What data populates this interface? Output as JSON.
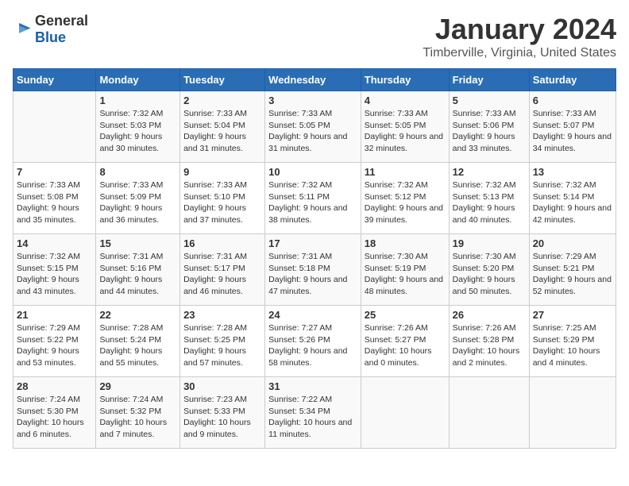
{
  "header": {
    "logo_general": "General",
    "logo_blue": "Blue",
    "month": "January 2024",
    "location": "Timberville, Virginia, United States"
  },
  "weekdays": [
    "Sunday",
    "Monday",
    "Tuesday",
    "Wednesday",
    "Thursday",
    "Friday",
    "Saturday"
  ],
  "weeks": [
    [
      {
        "day": "",
        "sunrise": "",
        "sunset": "",
        "daylight": ""
      },
      {
        "day": "1",
        "sunrise": "Sunrise: 7:32 AM",
        "sunset": "Sunset: 5:03 PM",
        "daylight": "Daylight: 9 hours and 30 minutes."
      },
      {
        "day": "2",
        "sunrise": "Sunrise: 7:33 AM",
        "sunset": "Sunset: 5:04 PM",
        "daylight": "Daylight: 9 hours and 31 minutes."
      },
      {
        "day": "3",
        "sunrise": "Sunrise: 7:33 AM",
        "sunset": "Sunset: 5:05 PM",
        "daylight": "Daylight: 9 hours and 31 minutes."
      },
      {
        "day": "4",
        "sunrise": "Sunrise: 7:33 AM",
        "sunset": "Sunset: 5:05 PM",
        "daylight": "Daylight: 9 hours and 32 minutes."
      },
      {
        "day": "5",
        "sunrise": "Sunrise: 7:33 AM",
        "sunset": "Sunset: 5:06 PM",
        "daylight": "Daylight: 9 hours and 33 minutes."
      },
      {
        "day": "6",
        "sunrise": "Sunrise: 7:33 AM",
        "sunset": "Sunset: 5:07 PM",
        "daylight": "Daylight: 9 hours and 34 minutes."
      }
    ],
    [
      {
        "day": "7",
        "sunrise": "Sunrise: 7:33 AM",
        "sunset": "Sunset: 5:08 PM",
        "daylight": "Daylight: 9 hours and 35 minutes."
      },
      {
        "day": "8",
        "sunrise": "Sunrise: 7:33 AM",
        "sunset": "Sunset: 5:09 PM",
        "daylight": "Daylight: 9 hours and 36 minutes."
      },
      {
        "day": "9",
        "sunrise": "Sunrise: 7:33 AM",
        "sunset": "Sunset: 5:10 PM",
        "daylight": "Daylight: 9 hours and 37 minutes."
      },
      {
        "day": "10",
        "sunrise": "Sunrise: 7:32 AM",
        "sunset": "Sunset: 5:11 PM",
        "daylight": "Daylight: 9 hours and 38 minutes."
      },
      {
        "day": "11",
        "sunrise": "Sunrise: 7:32 AM",
        "sunset": "Sunset: 5:12 PM",
        "daylight": "Daylight: 9 hours and 39 minutes."
      },
      {
        "day": "12",
        "sunrise": "Sunrise: 7:32 AM",
        "sunset": "Sunset: 5:13 PM",
        "daylight": "Daylight: 9 hours and 40 minutes."
      },
      {
        "day": "13",
        "sunrise": "Sunrise: 7:32 AM",
        "sunset": "Sunset: 5:14 PM",
        "daylight": "Daylight: 9 hours and 42 minutes."
      }
    ],
    [
      {
        "day": "14",
        "sunrise": "Sunrise: 7:32 AM",
        "sunset": "Sunset: 5:15 PM",
        "daylight": "Daylight: 9 hours and 43 minutes."
      },
      {
        "day": "15",
        "sunrise": "Sunrise: 7:31 AM",
        "sunset": "Sunset: 5:16 PM",
        "daylight": "Daylight: 9 hours and 44 minutes."
      },
      {
        "day": "16",
        "sunrise": "Sunrise: 7:31 AM",
        "sunset": "Sunset: 5:17 PM",
        "daylight": "Daylight: 9 hours and 46 minutes."
      },
      {
        "day": "17",
        "sunrise": "Sunrise: 7:31 AM",
        "sunset": "Sunset: 5:18 PM",
        "daylight": "Daylight: 9 hours and 47 minutes."
      },
      {
        "day": "18",
        "sunrise": "Sunrise: 7:30 AM",
        "sunset": "Sunset: 5:19 PM",
        "daylight": "Daylight: 9 hours and 48 minutes."
      },
      {
        "day": "19",
        "sunrise": "Sunrise: 7:30 AM",
        "sunset": "Sunset: 5:20 PM",
        "daylight": "Daylight: 9 hours and 50 minutes."
      },
      {
        "day": "20",
        "sunrise": "Sunrise: 7:29 AM",
        "sunset": "Sunset: 5:21 PM",
        "daylight": "Daylight: 9 hours and 52 minutes."
      }
    ],
    [
      {
        "day": "21",
        "sunrise": "Sunrise: 7:29 AM",
        "sunset": "Sunset: 5:22 PM",
        "daylight": "Daylight: 9 hours and 53 minutes."
      },
      {
        "day": "22",
        "sunrise": "Sunrise: 7:28 AM",
        "sunset": "Sunset: 5:24 PM",
        "daylight": "Daylight: 9 hours and 55 minutes."
      },
      {
        "day": "23",
        "sunrise": "Sunrise: 7:28 AM",
        "sunset": "Sunset: 5:25 PM",
        "daylight": "Daylight: 9 hours and 57 minutes."
      },
      {
        "day": "24",
        "sunrise": "Sunrise: 7:27 AM",
        "sunset": "Sunset: 5:26 PM",
        "daylight": "Daylight: 9 hours and 58 minutes."
      },
      {
        "day": "25",
        "sunrise": "Sunrise: 7:26 AM",
        "sunset": "Sunset: 5:27 PM",
        "daylight": "Daylight: 10 hours and 0 minutes."
      },
      {
        "day": "26",
        "sunrise": "Sunrise: 7:26 AM",
        "sunset": "Sunset: 5:28 PM",
        "daylight": "Daylight: 10 hours and 2 minutes."
      },
      {
        "day": "27",
        "sunrise": "Sunrise: 7:25 AM",
        "sunset": "Sunset: 5:29 PM",
        "daylight": "Daylight: 10 hours and 4 minutes."
      }
    ],
    [
      {
        "day": "28",
        "sunrise": "Sunrise: 7:24 AM",
        "sunset": "Sunset: 5:30 PM",
        "daylight": "Daylight: 10 hours and 6 minutes."
      },
      {
        "day": "29",
        "sunrise": "Sunrise: 7:24 AM",
        "sunset": "Sunset: 5:32 PM",
        "daylight": "Daylight: 10 hours and 7 minutes."
      },
      {
        "day": "30",
        "sunrise": "Sunrise: 7:23 AM",
        "sunset": "Sunset: 5:33 PM",
        "daylight": "Daylight: 10 hours and 9 minutes."
      },
      {
        "day": "31",
        "sunrise": "Sunrise: 7:22 AM",
        "sunset": "Sunset: 5:34 PM",
        "daylight": "Daylight: 10 hours and 11 minutes."
      },
      {
        "day": "",
        "sunrise": "",
        "sunset": "",
        "daylight": ""
      },
      {
        "day": "",
        "sunrise": "",
        "sunset": "",
        "daylight": ""
      },
      {
        "day": "",
        "sunrise": "",
        "sunset": "",
        "daylight": ""
      }
    ]
  ]
}
